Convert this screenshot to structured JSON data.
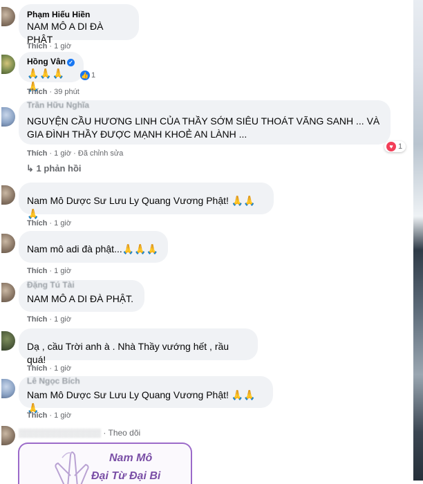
{
  "comments": [
    {
      "author": "Phạm Hiếu Hiền",
      "text": "NAM MÔ A DI ĐÀ PHẬT",
      "like_label": "Thích",
      "time": "1 giờ"
    },
    {
      "author": "Hồng Vân",
      "text": "🙏🙏🙏🙏",
      "reaction_count": "1",
      "like_label": "Thích",
      "time": "39 phút"
    },
    {
      "author": "Trần Hữu Nghĩa",
      "text": "NGUYỆN CẦU HƯƠNG LINH CỦA THẦY SỚM SIÊU THOÁT VÃNG SANH ... VÀ GIA ĐÌNH THẦY ĐƯỢC MẠNH KHOẺ AN LÀNH ...",
      "reaction_count": "1",
      "like_label": "Thích",
      "time": "1 giờ",
      "edited": "Đã chỉnh sửa",
      "replies": "1 phản hồi"
    },
    {
      "author": "",
      "text": "Nam Mô Dược Sư Lưu Ly Quang Vương Phật! 🙏🙏🙏",
      "like_label": "Thích",
      "time": "1 giờ"
    },
    {
      "author": "",
      "text": "Nam mô adi đà phật...🙏🙏🙏",
      "like_label": "Thích",
      "time": "1 giờ"
    },
    {
      "author": "Đặng Tú Tài",
      "text": "NAM MÔ A DI ĐÀ PHẬT.",
      "like_label": "Thích",
      "time": "1 giờ"
    },
    {
      "author": "",
      "text": "Dạ , cầu Trời anh à . Nhà Thầy vướng hết , rầu quá!",
      "like_label": "Thích",
      "time": "1 giờ"
    },
    {
      "author": "Lê Ngọc Bích",
      "text": "Nam Mô Dược Sư Lưu Ly Quang Vương Phật! 🙏🙏🙏",
      "like_label": "Thích",
      "time": "1 giờ"
    }
  ],
  "last": {
    "follow_label": "Theo dõi",
    "sticker_line1": "Nam Mô",
    "sticker_line2": "Đại Từ Đại Bi"
  },
  "separator": "·",
  "colors": {
    "bubble": "#f0f2f5",
    "meta": "#65676b",
    "like_blue": "#1877f2",
    "heart_red": "#f33e58",
    "sticker_purple": "#7a4fa6"
  }
}
